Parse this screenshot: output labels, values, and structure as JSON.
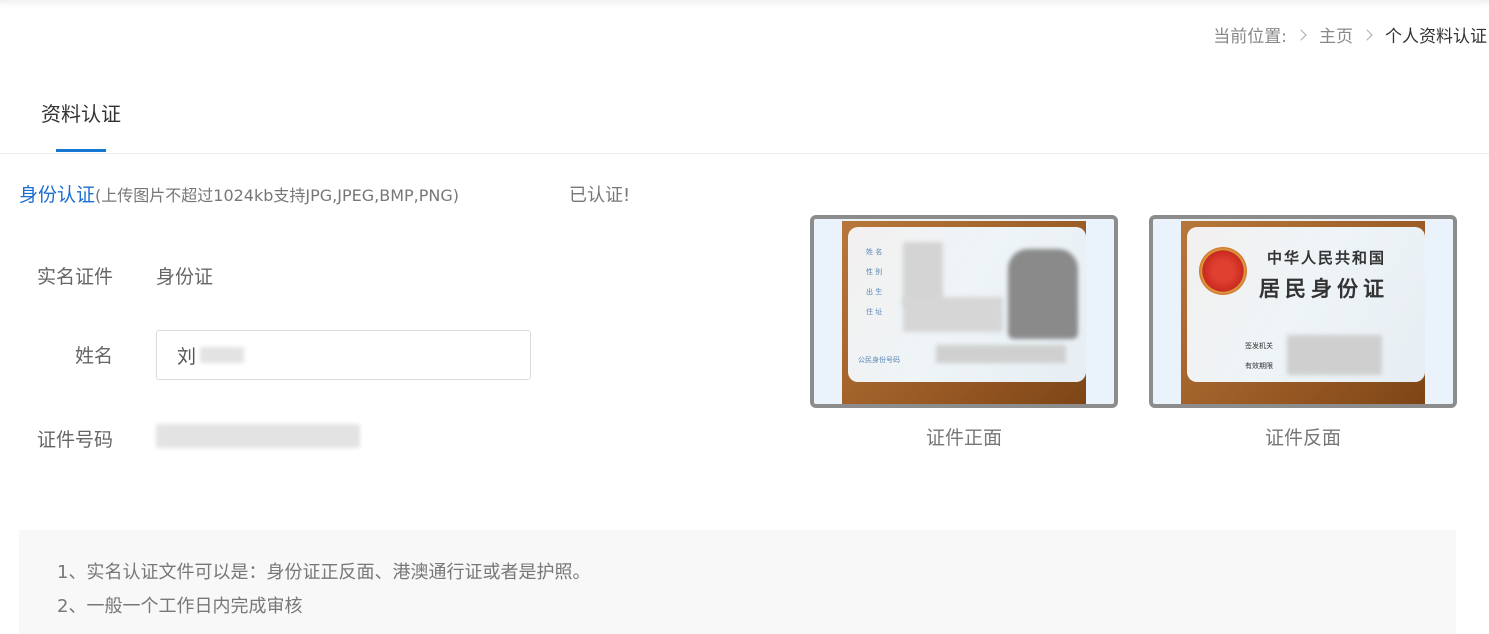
{
  "breadcrumb": {
    "prefix": "当前位置:",
    "home": "主页",
    "current": "个人资料认证"
  },
  "tabs": [
    {
      "label": "资料认证",
      "active": true
    }
  ],
  "identity": {
    "title": "身份认证",
    "hint": "(上传图片不超过1024kb支持JPG,JPEG,BMP,PNG)",
    "status": "已认证!"
  },
  "form": {
    "doc_type_label": "实名证件",
    "doc_type_value": "身份证",
    "name_label": "姓名",
    "name_value": "刘",
    "id_number_label": "证件号码"
  },
  "cards": {
    "front_caption": "证件正面",
    "back_caption": "证件反面",
    "front_fields": [
      "姓 名",
      "性 别",
      "出 生",
      "住 址",
      "公民身份号码"
    ],
    "back_title_line1": "中华人民共和国",
    "back_title_line2": "居民身份证",
    "back_fields": [
      "签发机关",
      "有效期限"
    ]
  },
  "notes": [
    "1、实名认证文件可以是：身份证正反面、港澳通行证或者是护照。",
    "2、一般一个工作日内完成审核"
  ],
  "colors": {
    "accent": "#1677d2",
    "link_blue": "#1c6fd0"
  }
}
